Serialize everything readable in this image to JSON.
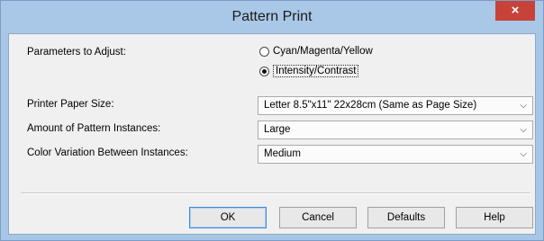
{
  "window": {
    "title": "Pattern Print",
    "close_glyph": "×"
  },
  "params": {
    "label": "Parameters to Adjust:",
    "options": [
      {
        "label": "Cyan/Magenta/Yellow",
        "selected": false
      },
      {
        "label": "Intensity/Contrast",
        "selected": true
      }
    ]
  },
  "paper_size": {
    "label": "Printer Paper Size:",
    "value": "Letter 8.5\"x11\" 22x28cm (Same as Page Size)"
  },
  "amount": {
    "label": "Amount of Pattern Instances:",
    "value": "Large"
  },
  "variation": {
    "label": "Color Variation Between Instances:",
    "value": "Medium"
  },
  "buttons": {
    "ok": "OK",
    "cancel": "Cancel",
    "defaults": "Defaults",
    "help": "Help"
  },
  "icons": {
    "chevron": "chevron-down-icon",
    "close": "close-icon"
  }
}
